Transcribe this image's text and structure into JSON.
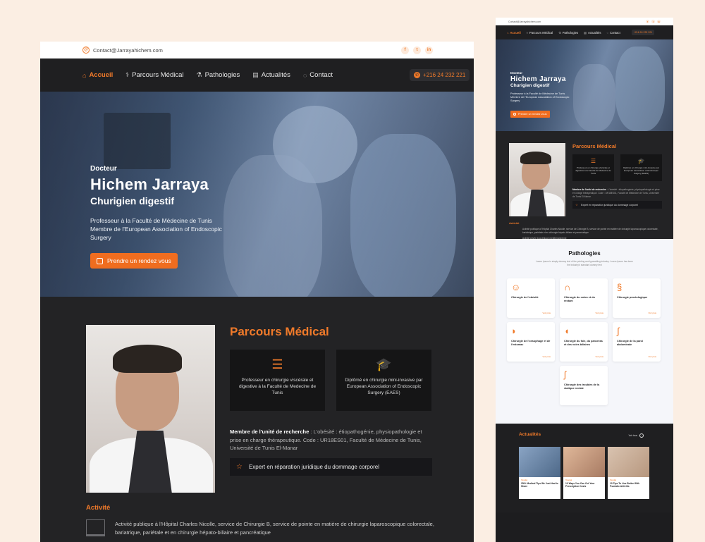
{
  "contact": {
    "email": "Contact@Jarrayahichem.com",
    "socials": [
      "f",
      "t",
      "in"
    ],
    "phone": "+216 24 232 221"
  },
  "nav": {
    "items": [
      {
        "label": "Accueil",
        "icon": "home-icon"
      },
      {
        "label": "Parcours Médical",
        "icon": "stethoscope-icon"
      },
      {
        "label": "Pathologies",
        "icon": "flask-icon"
      },
      {
        "label": "Actualités",
        "icon": "newspaper-icon"
      },
      {
        "label": "Contact",
        "icon": "chat-icon"
      }
    ]
  },
  "hero": {
    "kicker": "Docteur",
    "name": "Hichem Jarraya",
    "specialty": "Churigien digestif",
    "desc_line1": "Professeur à la Faculté de Médecine de Tunis",
    "desc_line2": "Membre de l'European Association of Endoscopic Surgery",
    "cta": "Prendre un rendez vous"
  },
  "parcours": {
    "title": "Parcours Médical",
    "cards": [
      {
        "text": "Professeur en chirurgie viscérale et digestive à la Faculté de Medecine de Tunis"
      },
      {
        "text": "Diplômé en chirurgie mini-invasive par European Association of Endoscopic Surgery (EAES)"
      }
    ],
    "research_label": "Membre de l'unité de recherche",
    "research_text": " : L'obésité : étiopathogénie, physiopathologie et prise en charge  thérapeutique. Code : UR18ES01, Faculté de Médecine de Tunis, Université de Tunis El-Manar",
    "expert": "Expert en réparation juridique du dommage corporel"
  },
  "activite": {
    "title": "Activité",
    "text": "Activité publique à l'Hôpital Charles Nicolle, service de Chirurgie B, service de pointe en matière de chirurgie laparoscopique colorectale, bariatrique, pariétale et en chirurgie hépato-biliaire et  pancréatique",
    "text2": "Activité privée à la clinique mediterraneenne"
  },
  "pathologies": {
    "title": "Pathologies",
    "subtitle": "Lorem Ipsum is simply dummy text of the printing and typesetting industry. Lorem Ipsum has been the industry's standard dummy text",
    "more": "Voir plus",
    "items": [
      {
        "title": "Chirurgie de l'obésité",
        "icon": "body-icon"
      },
      {
        "title": "Chirurgie du colon et du rectum",
        "icon": "colon-icon"
      },
      {
        "title": "Chirurgie proctologique",
        "icon": "intestine-icon"
      },
      {
        "title": "Chirurgie de l'oesophage et de l'estomac",
        "icon": "stomach-icon"
      },
      {
        "title": "Chirurgie du foie, du pancréas et des voies biliaires",
        "icon": "liver-icon"
      },
      {
        "title": "Chirurgie de la paroi abdominale",
        "icon": "abdomen-icon"
      },
      {
        "title": "Chirurgie des troubles de la statique rectale",
        "icon": "rectum-icon"
      }
    ]
  },
  "actualites": {
    "title": "Actualités",
    "see_all": "Voir tous",
    "items": [
      {
        "title": "250+ Medical Tips We Just Had to Share",
        "meta": "Hospital"
      },
      {
        "title": "10 Ways You Can Cut Your Prescription Costs",
        "meta": "Hospital"
      },
      {
        "title": "10 Tips To Live Better With Psoriatic Arthritis",
        "meta": "Hospital"
      }
    ]
  }
}
